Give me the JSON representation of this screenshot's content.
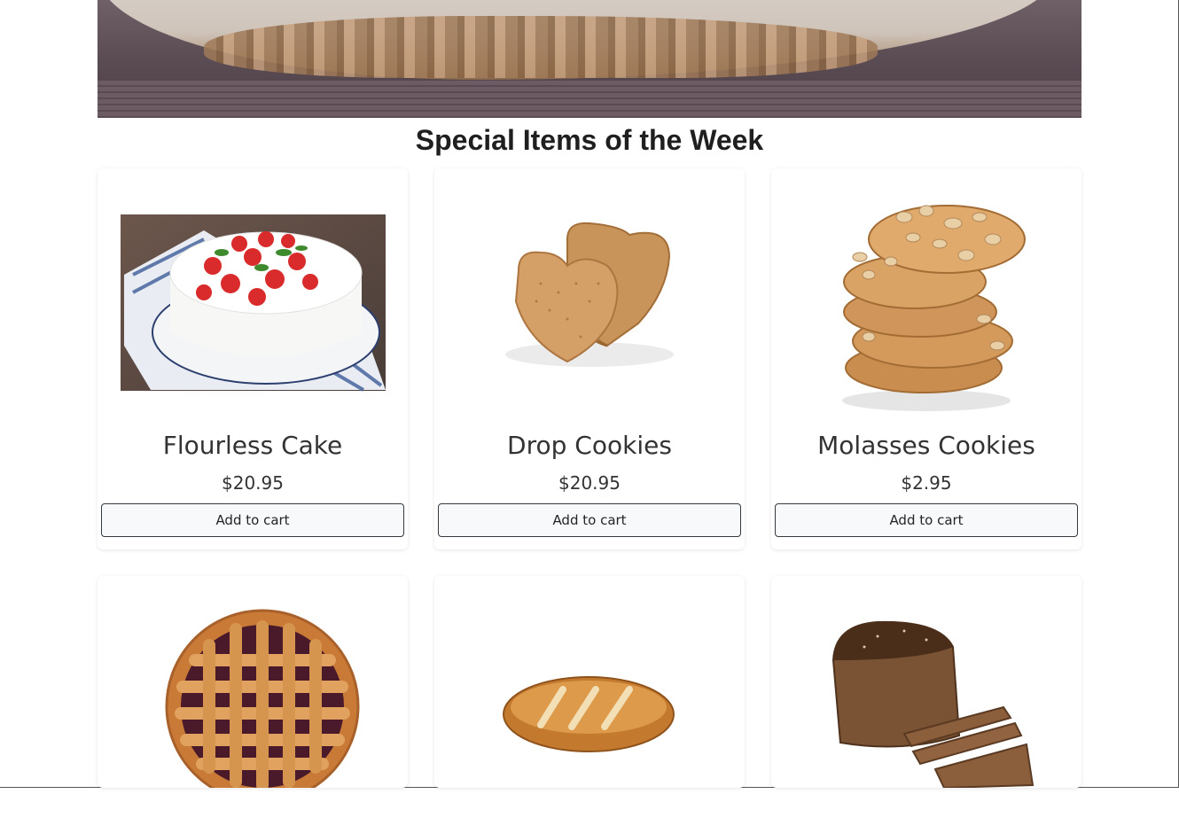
{
  "section_title": "Special Items of the Week",
  "products": [
    {
      "name": "Flourless Cake",
      "price": "$20.95",
      "button": "Add to cart"
    },
    {
      "name": "Drop Cookies",
      "price": "$20.95",
      "button": "Add to cart"
    },
    {
      "name": "Molasses Cookies",
      "price": "$2.95",
      "button": "Add to cart"
    },
    {
      "name": "",
      "price": "",
      "button": ""
    },
    {
      "name": "",
      "price": "",
      "button": ""
    },
    {
      "name": "",
      "price": "",
      "button": ""
    }
  ],
  "colors": {
    "button_bg": "#f8f9fa",
    "button_border": "#343a40",
    "title": "#1f1f1f"
  }
}
